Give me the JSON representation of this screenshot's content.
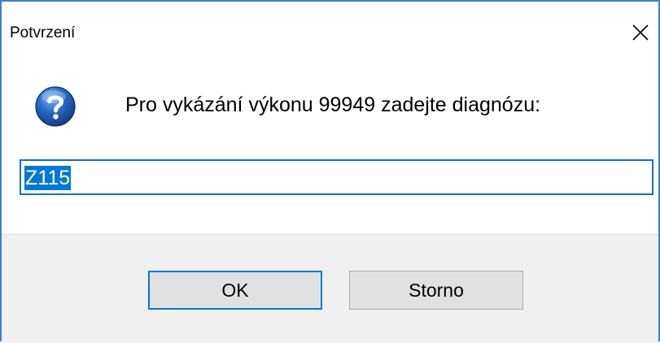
{
  "dialog": {
    "title": "Potvrzení",
    "close_glyph": "✕",
    "prompt": "Pro vykázání výkonu 99949 zadejte diagnózu:",
    "icon": "question-icon",
    "input_value": "Z115",
    "buttons": {
      "ok_label": "OK",
      "cancel_label": "Storno"
    }
  },
  "colors": {
    "accent": "#0078d7",
    "window_border": "#3c7fd8",
    "footer_bg": "#f0f0f0",
    "button_bg": "#e1e1e1"
  }
}
